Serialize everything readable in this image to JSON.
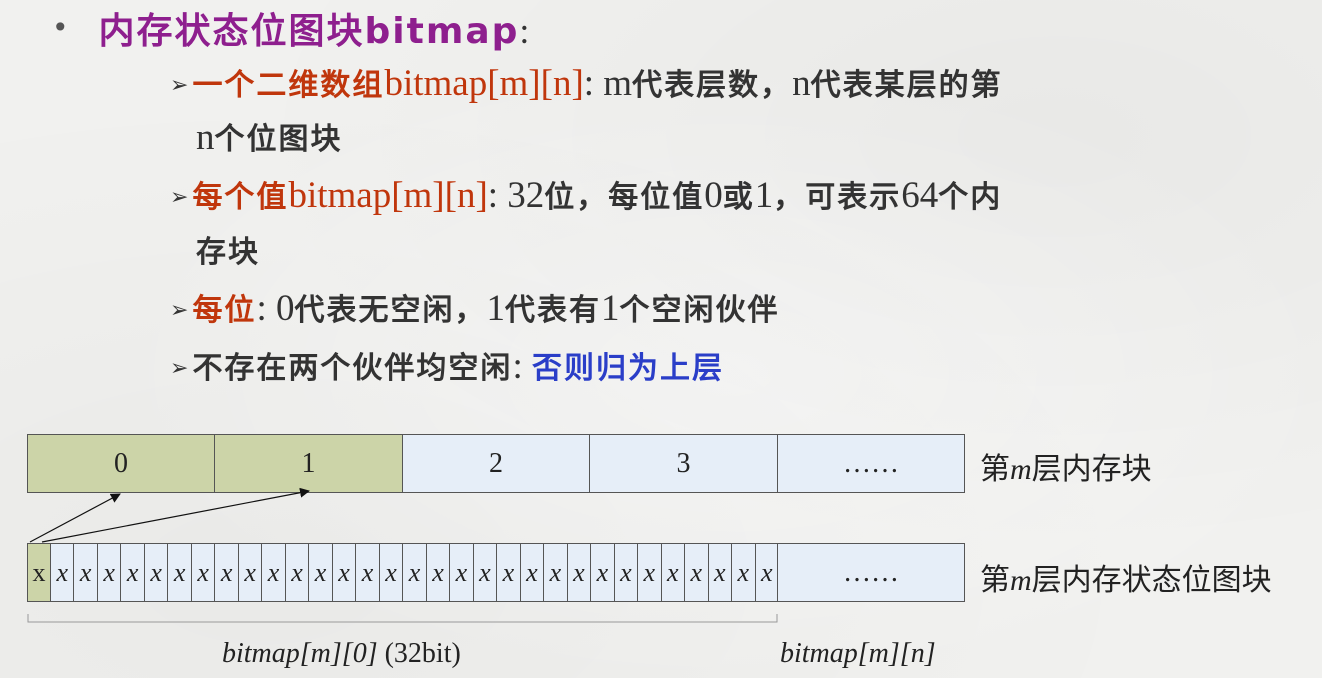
{
  "header": {
    "bullet": "•",
    "title": "内存状态位图块bitmap",
    "colon": ":"
  },
  "items": [
    {
      "red_cjk": "一个二维数组",
      "red_lat": "bitmap[m][n]",
      "sep": ": ",
      "lat1": "m",
      "cjk1": "代表层数，",
      "lat2": "n",
      "cjk2": "代表某层的第",
      "cont_lat": "n",
      "cont_cjk": "个位图块"
    },
    {
      "red_cjk": "每个值",
      "red_lat": "bitmap[m][n]",
      "sep": ": ",
      "lat1": "32",
      "cjk1": "位，每位值",
      "lat2": "0",
      "cjk2": "或",
      "lat3": "1",
      "cjk3": "，可表示",
      "lat4": "64",
      "cjk4": "个内",
      "cont_cjk": "存块"
    },
    {
      "red_cjk": "每位",
      "sep": ": ",
      "lat1": "0",
      "cjk1": "代表无空闲，",
      "lat2": "1",
      "cjk2": "代表有",
      "lat3": "1",
      "cjk3": "个空闲伙伴"
    },
    {
      "dark_cjk": "不存在两个伙伴均空闲",
      "sep": ": ",
      "blue_cjk": "否则归为上层"
    }
  ],
  "diagram": {
    "blocks": [
      "0",
      "1",
      "2",
      "3",
      "……"
    ],
    "block_label_pre": "第",
    "block_label_m": "m",
    "block_label_post": "层内存块",
    "bits_first": "x",
    "bit_symbol": "x",
    "bits_ellipsis": "……",
    "bits_label_pre": "第",
    "bits_label_m": "m",
    "bits_label_post": "层内存状态位图块",
    "bracket_label": "bitmap[m][0]",
    "bracket_suffix": " (32bit)",
    "n_label": "bitmap[m][n]",
    "colors": {
      "used": "#ccd4a8",
      "free": "#e6eef8"
    }
  }
}
